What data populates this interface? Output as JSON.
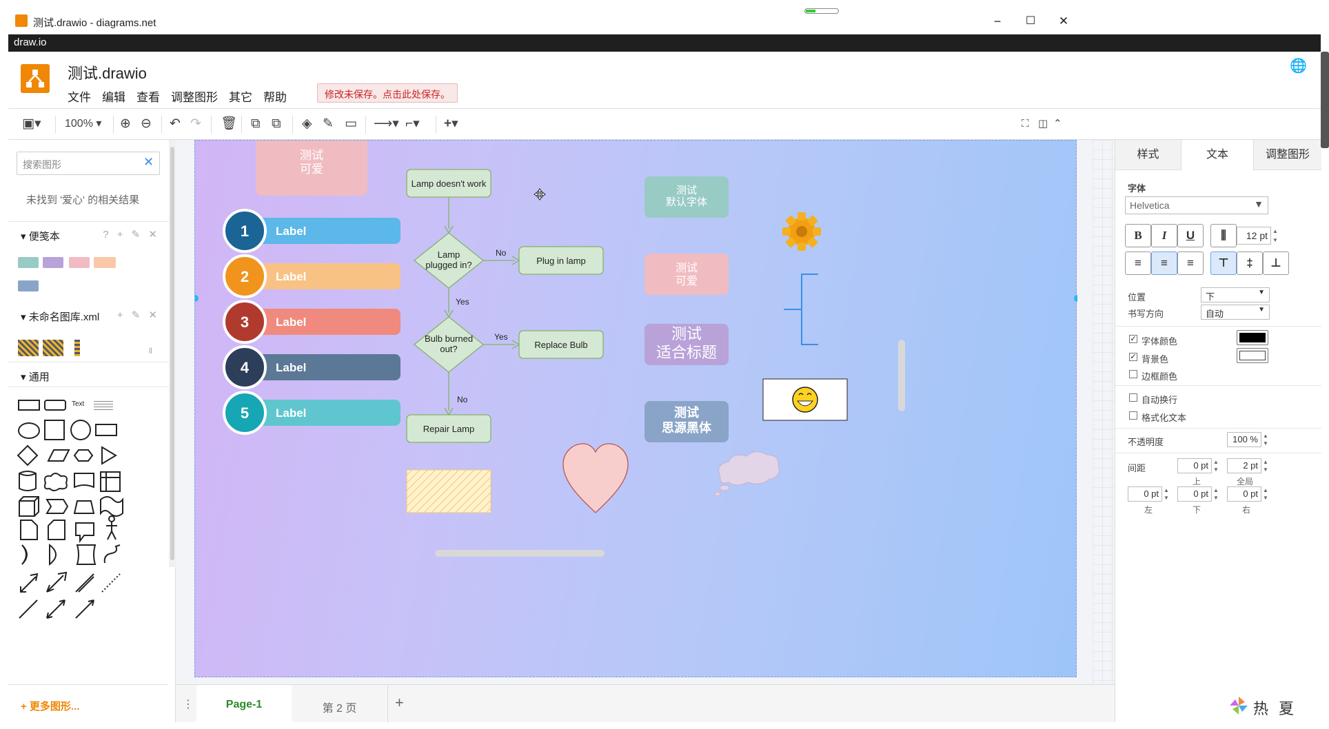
{
  "window": {
    "title": "测试.drawio - diagrams.net",
    "app_bar": "draw.io",
    "minimize": "−",
    "maximize": "☐",
    "close": "✕"
  },
  "header": {
    "doc_title": "测试.drawio",
    "menu": [
      "文件",
      "编辑",
      "查看",
      "调整图形",
      "其它",
      "帮助"
    ],
    "unsaved_notice": "修改未保存。点击此处保存。"
  },
  "toolbar": {
    "zoom": "100%"
  },
  "left": {
    "search_placeholder": "搜索图形",
    "no_result": "未找到 '爱心' 的相关结果",
    "sections": [
      {
        "label": "便笺本",
        "icons": "? + ✎ ✕"
      },
      {
        "label": "未命名图库.xml",
        "icons": "+ ✎ ✕"
      },
      {
        "label": "通用"
      }
    ],
    "shape_text": "Text",
    "more_shapes": "+ 更多图形..."
  },
  "canvas": {
    "top_note": "测试\n可爱",
    "list_items": [
      {
        "num": "1",
        "label": "Label",
        "color": "#1a6496",
        "bar": "#5bb8e8"
      },
      {
        "num": "2",
        "label": "Label",
        "color": "#f0941d",
        "bar": "#f9c285"
      },
      {
        "num": "3",
        "label": "Label",
        "color": "#b03a2e",
        "bar": "#f08a7e"
      },
      {
        "num": "4",
        "label": "Label",
        "color": "#2c3e5a",
        "bar": "#5b7896"
      },
      {
        "num": "5",
        "label": "Label",
        "color": "#17a6b4",
        "bar": "#5fc6d0"
      }
    ],
    "flow": {
      "start": "Lamp doesn't work",
      "q1": "Lamp plugged in?",
      "no1": "No",
      "plug": "Plug in lamp",
      "yes1": "Yes",
      "q2": "Bulb burned out?",
      "yes2": "Yes",
      "replace": "Replace Bulb",
      "no2": "No",
      "repair": "Repair Lamp"
    },
    "styled_boxes": [
      {
        "text": "测试\n默认字体",
        "bg": "#98cbc4"
      },
      {
        "text": "测试\n可爱",
        "bg": "#f0bcc2"
      },
      {
        "text": "测试\n适合标题",
        "bg": "#b8a2d8"
      },
      {
        "text": "测试\n思源黑体",
        "bg": "#8aa4c8"
      }
    ]
  },
  "pages": {
    "menu_icon": "⋮",
    "tabs": [
      "Page-1",
      "第 2 页"
    ],
    "add": "+"
  },
  "right": {
    "tabs": [
      "样式",
      "文本",
      "调整图形"
    ],
    "font_label": "字体",
    "font": "Helvetica",
    "font_size": "12 pt",
    "position_label": "位置",
    "position_value": "下",
    "writing_label": "书写方向",
    "writing_value": "自动",
    "font_color": "字体颜色",
    "bg_color": "背景色",
    "border_color": "边框颜色",
    "autowrap": "自动换行",
    "formatted": "格式化文本",
    "opacity_label": "不透明度",
    "opacity": "100 %",
    "spacing_label": "间距",
    "sp_top": "0 pt",
    "sp_top_lbl": "上",
    "sp_global": "2 pt",
    "sp_global_lbl": "全局",
    "sp_left": "0 pt",
    "sp_left_lbl": "左",
    "sp_bottom": "0 pt",
    "sp_bottom_lbl": "下",
    "sp_right": "0 pt",
    "sp_right_lbl": "右"
  },
  "watermark": "热 夏"
}
